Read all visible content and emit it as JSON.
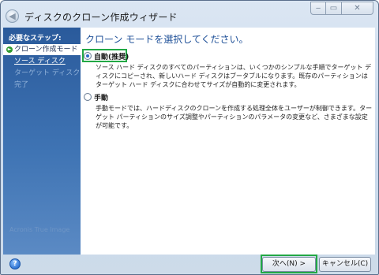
{
  "window": {
    "title": "ディスクのクローン作成ウィザード",
    "controls": {
      "minimize": "‒",
      "maximize": "▭",
      "close": "✕"
    }
  },
  "sidebar": {
    "header": "必要なステップ:",
    "items": [
      {
        "label": "クローン作成モード",
        "state": "active"
      },
      {
        "label": "ソース ディスク",
        "state": "link"
      },
      {
        "label": "ターゲット ディスク",
        "state": "disabled"
      },
      {
        "label": "完了",
        "state": "disabled"
      }
    ],
    "watermark": "Acronis True Image"
  },
  "main": {
    "heading": "クローン モードを選択してください。",
    "options": [
      {
        "label": "自動(推奨)",
        "selected": true,
        "description": "ソース ハード ディスクのすべてのパーティションは、いくつかのシンプルな手順でターゲット ディスクにコピーされ、新しいハード ディスクはブータブルになります。既存のパーティションはターゲット ハード ディスクに合わせてサイズが自動的に変更されます。"
      },
      {
        "label": "手動",
        "selected": false,
        "description": "手動モードでは、ハードディスクのクローンを作成する処理全体をユーザーが制御できます。ターゲット パーティションのサイズ調整やパーティションのパラメータの変更など、さまざまな設定が可能です。"
      }
    ]
  },
  "footer": {
    "help_icon": "?",
    "next_label": "次へ(N) >",
    "cancel_label": "キャンセル(C)"
  },
  "colors": {
    "highlight": "#22a845",
    "sidebar_top": "#2a5a9b",
    "heading": "#1d4f97"
  }
}
